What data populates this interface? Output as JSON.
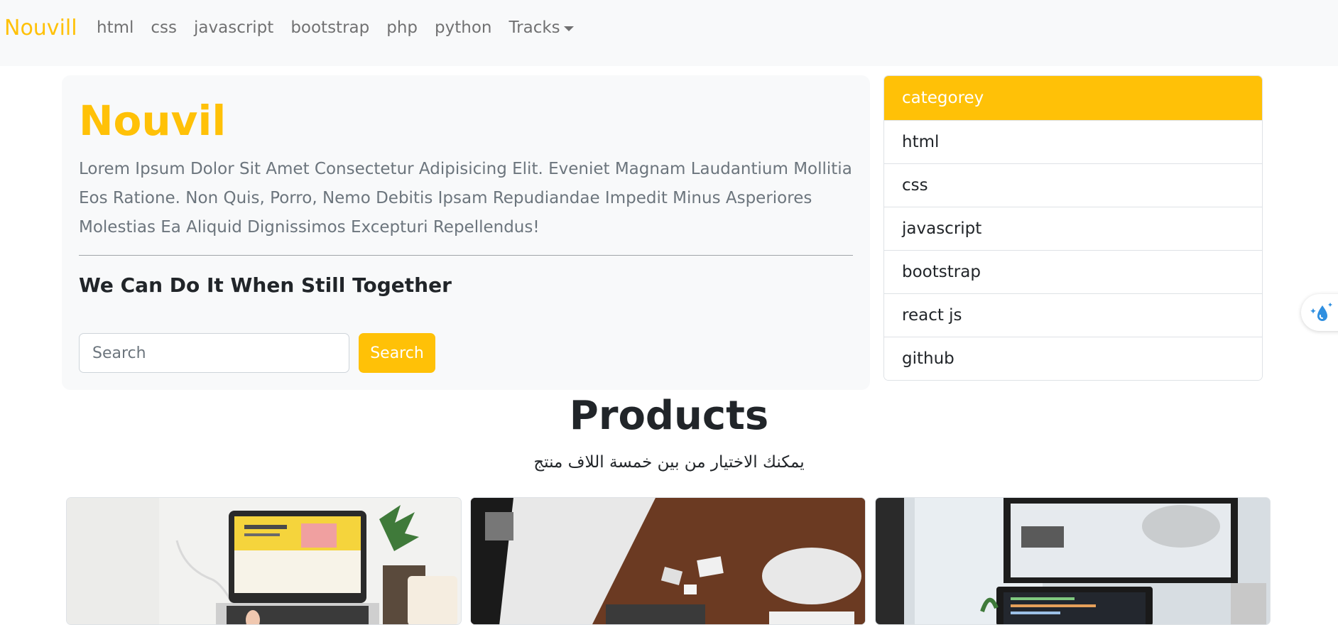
{
  "navbar": {
    "brand": "Nouvill",
    "links": [
      "html",
      "css",
      "javascript",
      "bootstrap",
      "php",
      "python"
    ],
    "dropdown_label": "Tracks"
  },
  "hero": {
    "title": "Nouvil",
    "text": "Lorem Ipsum Dolor Sit Amet Consectetur Adipisicing Elit. Eveniet Magnam Laudantium Mollitia Eos Ratione. Non Quis, Porro, Nemo Debitis Ipsam Repudiandae Impedit Minus Asperiores Molestias Ea Aliquid Dignissimos Excepturi Repellendus!",
    "subtitle": "We Can Do It When Still Together",
    "search_placeholder": "Search",
    "search_button": "Search"
  },
  "category": {
    "header": "categorey",
    "items": [
      "html",
      "css",
      "javascript",
      "bootstrap",
      "react js",
      "github"
    ]
  },
  "products": {
    "title": "Products",
    "subtitle": "يمكنك الاختيار من بين خمسة اللاف منتج"
  },
  "colors": {
    "accent": "#ffc107",
    "navbar_bg": "#f8f9fa",
    "text_muted": "#6c757d"
  },
  "icons": {
    "floating_widget": "water-drop-sparkle-icon"
  }
}
